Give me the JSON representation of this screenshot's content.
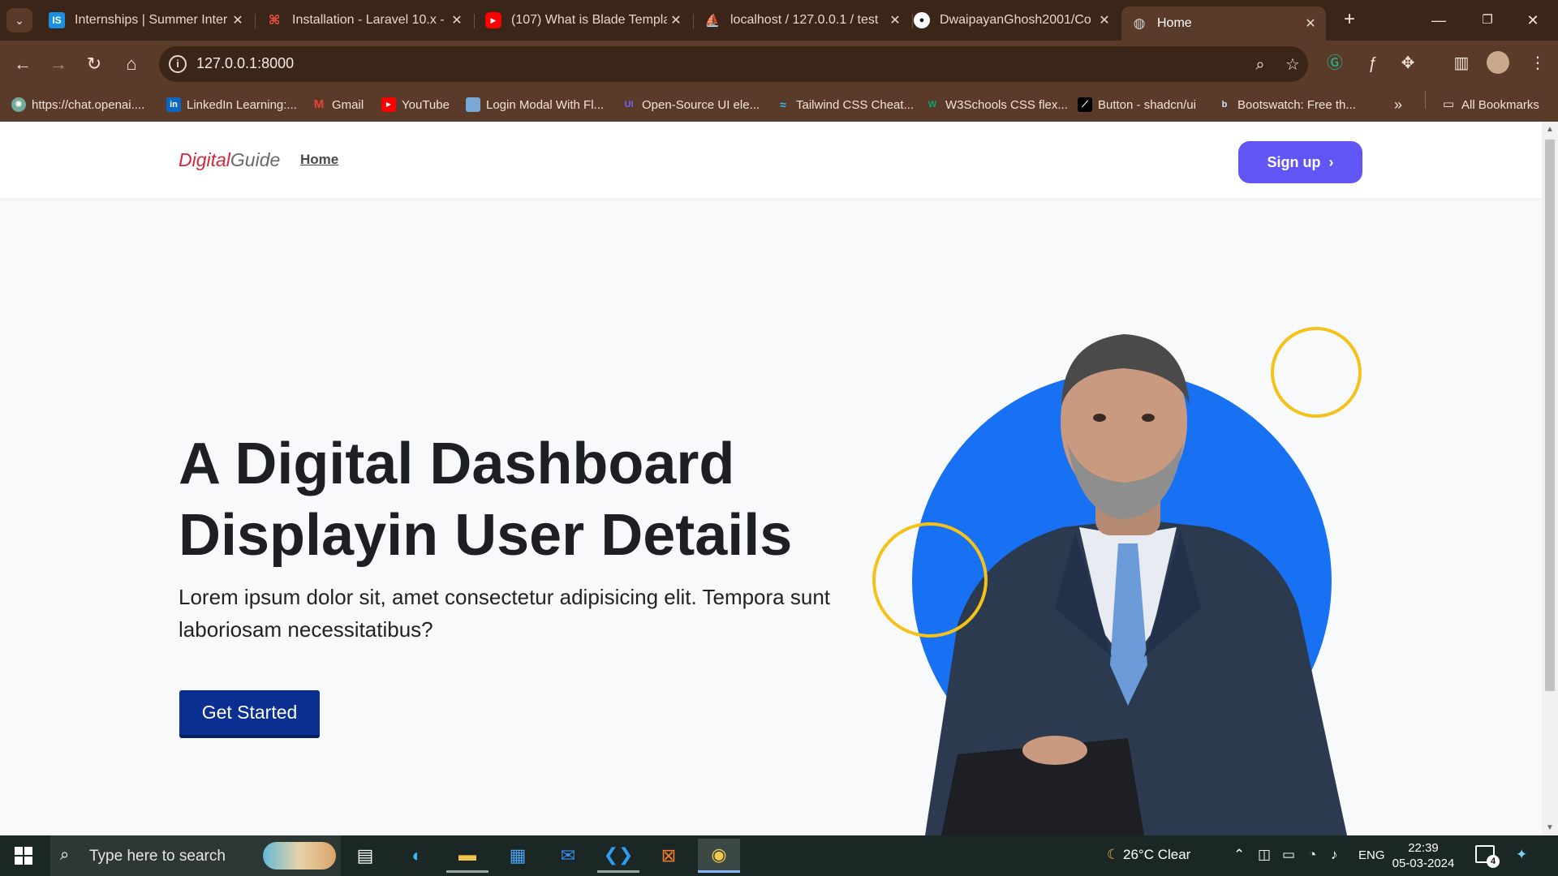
{
  "browser": {
    "tabs": [
      {
        "title": "Internships | Summer Inter",
        "favicon": "IS",
        "favicon_color": "#1a8fe3"
      },
      {
        "title": "Installation - Laravel 10.x -",
        "favicon": "laravel-icon",
        "favicon_color": "#f05340"
      },
      {
        "title": "(107) What is Blade Templa",
        "favicon": "youtube-icon",
        "favicon_color": "#ff0000"
      },
      {
        "title": "localhost / 127.0.0.1 / test",
        "favicon": "phpmyadmin-icon",
        "favicon_color": "#f29111"
      },
      {
        "title": "DwaipayanGhosh2001/Co",
        "favicon": "github-icon",
        "favicon_color": "#ffffff"
      },
      {
        "title": "Home",
        "favicon": "globe-icon",
        "favicon_color": "#cfcfcf",
        "active": true
      }
    ],
    "url": "127.0.0.1:8000",
    "bookmarks": [
      {
        "label": "https://chat.openai....",
        "icon": "openai-icon"
      },
      {
        "label": "LinkedIn Learning:...",
        "icon": "linkedin-icon"
      },
      {
        "label": "Gmail",
        "icon": "gmail-icon"
      },
      {
        "label": "YouTube",
        "icon": "youtube-icon"
      },
      {
        "label": "Login Modal With Fl...",
        "icon": "image-icon"
      },
      {
        "label": "Open-Source UI ele...",
        "icon": "ui-icon"
      },
      {
        "label": "Tailwind CSS Cheat...",
        "icon": "tailwind-icon"
      },
      {
        "label": "W3Schools CSS flex...",
        "icon": "w3schools-icon"
      },
      {
        "label": "Button - shadcn/ui",
        "icon": "shadcn-icon"
      },
      {
        "label": "Bootswatch: Free th...",
        "icon": "bootswatch-icon"
      }
    ],
    "all_bookmarks_label": "All Bookmarks"
  },
  "site": {
    "logo_part1": "Digital",
    "logo_part2": "Guide",
    "nav_home": "Home",
    "signup_label": "Sign up",
    "hero_title_line1": "A Digital Dashboard",
    "hero_title_line2": "Displayin User Details",
    "hero_text": "Lorem ipsum dolor sit, amet consectetur adipisicing elit. Tempora sunt laboriosam necessitatibus?",
    "cta_label": "Get Started",
    "colors": {
      "logo_accent": "#d6283a",
      "signup_bg": "#6155f5",
      "cta_bg": "#0b2f91",
      "circle": "#1871f3",
      "ring": "#f5c21a"
    }
  },
  "taskbar": {
    "search_placeholder": "Type here to search",
    "weather": "26°C  Clear",
    "language": "ENG",
    "time": "22:39",
    "date": "05-03-2024",
    "notification_count": "4"
  }
}
